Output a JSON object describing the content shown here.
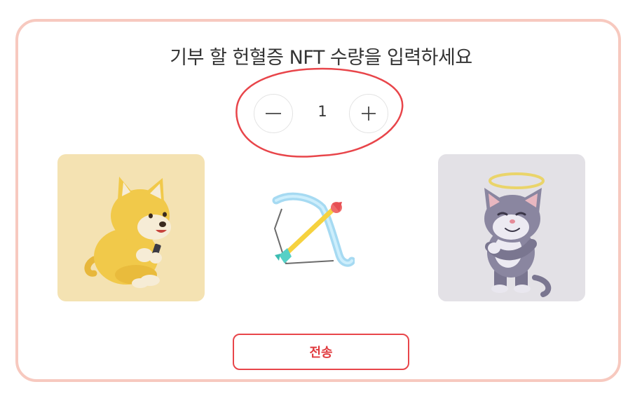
{
  "dialog": {
    "title": "기부 할 헌혈증 NFT 수량을 입력하세요"
  },
  "quantity": {
    "value": "1",
    "decrement_icon": "minus-icon",
    "increment_icon": "plus-icon"
  },
  "illustrations": {
    "left": "dog-holding-phone",
    "center": "cupid-bow-and-arrow",
    "right": "angel-cat-with-halo"
  },
  "actions": {
    "submit_label": "전송"
  },
  "colors": {
    "card_border": "#f7c9bf",
    "annotation_circle": "#e8454a",
    "submit_accent": "#e8454a",
    "left_tile_bg": "#f4e2b2",
    "right_tile_bg": "#e3e1e6"
  }
}
